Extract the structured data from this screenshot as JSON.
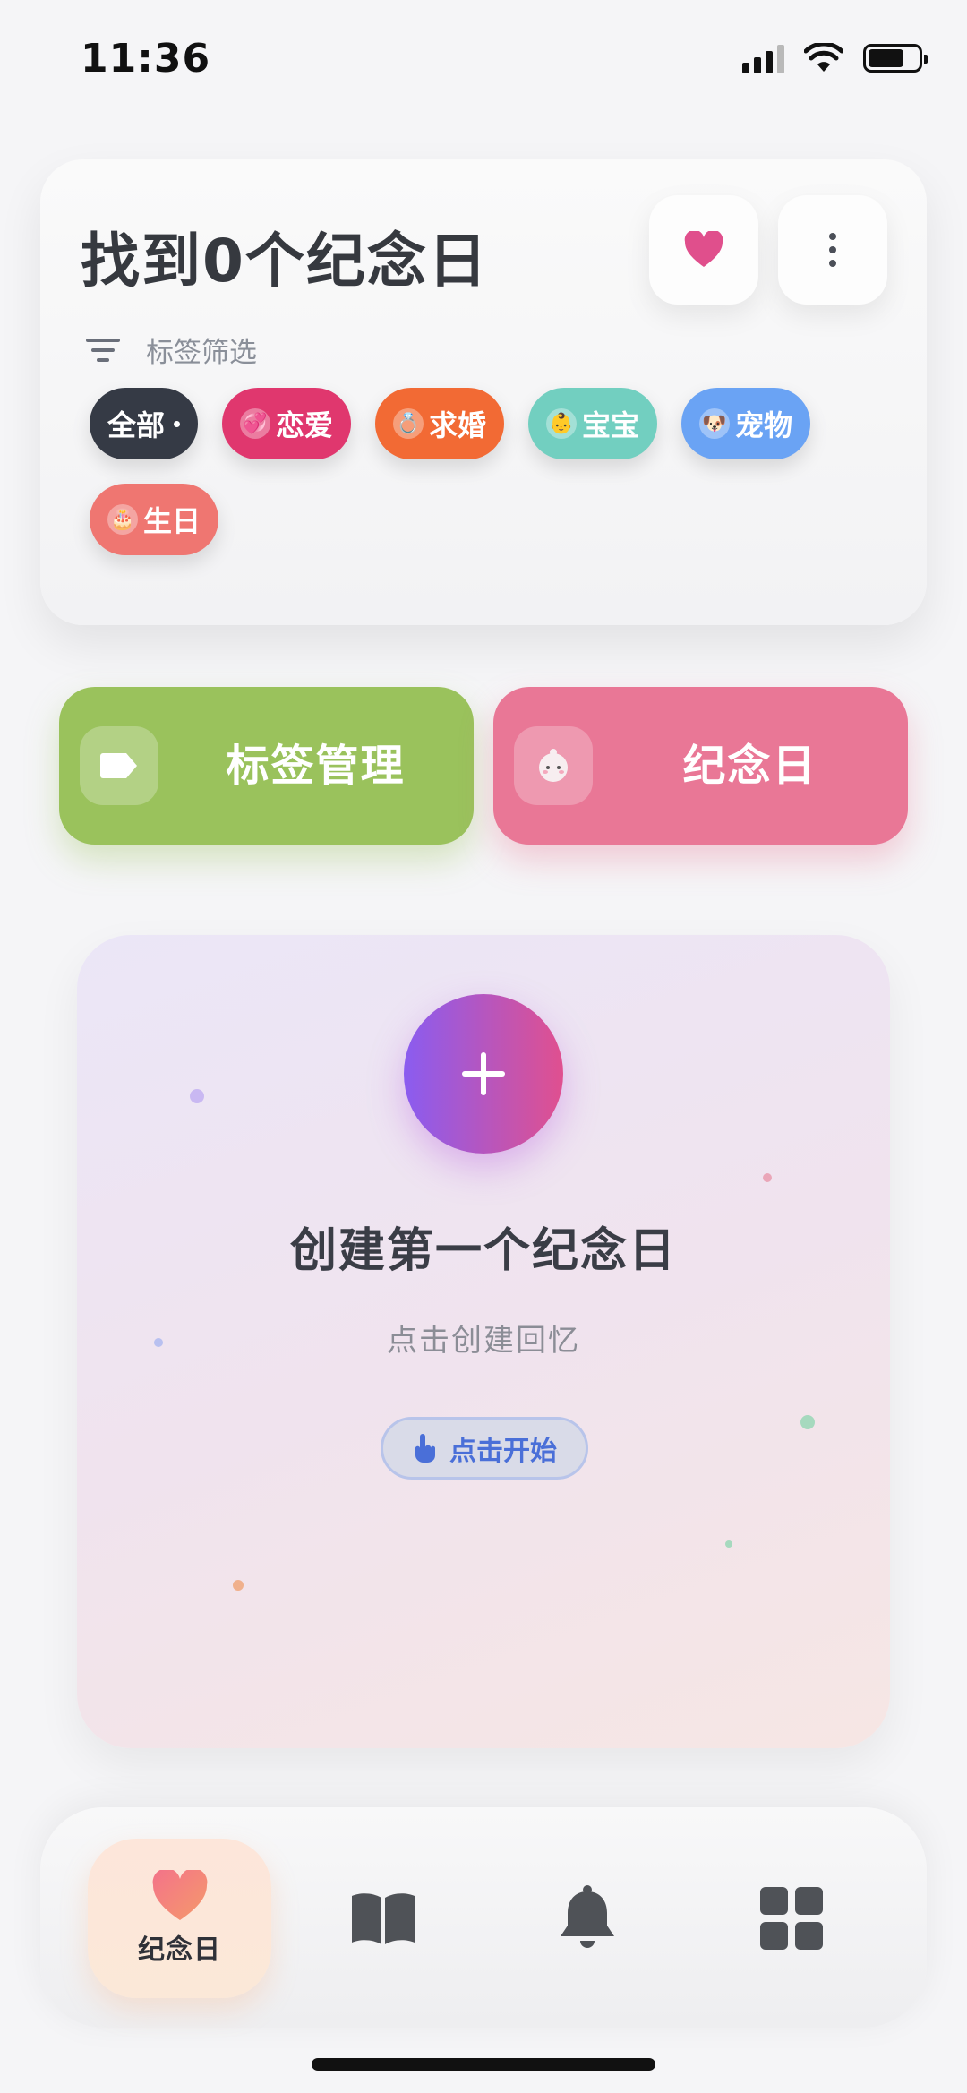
{
  "status_bar": {
    "time": "11:36"
  },
  "header": {
    "title": "找到0个纪念日"
  },
  "filter": {
    "label": "标签筛选"
  },
  "tags": [
    {
      "label": "全部",
      "color": "#353a45",
      "emoji": ""
    },
    {
      "label": "恋爱",
      "color": "#e0376e",
      "emoji": "💞"
    },
    {
      "label": "求婚",
      "color": "#f26a34",
      "emoji": "💍"
    },
    {
      "label": "宝宝",
      "color": "#72cfc0",
      "emoji": "👶"
    },
    {
      "label": "宠物",
      "color": "#6aa3f4",
      "emoji": "🐶"
    },
    {
      "label": "生日",
      "color": "#ef7671",
      "emoji": "🎂"
    }
  ],
  "actions": {
    "tags_label": "标签管理",
    "anniversary_label": "纪念日"
  },
  "empty_state": {
    "title": "创建第一个纪念日",
    "subtitle": "点击创建回忆",
    "cta_label": "点击开始"
  },
  "nav": {
    "home_label": "纪念日"
  },
  "colors": {
    "accent_pink": "#e04f8c",
    "tag_green": "#9ac25c",
    "anniversary_pink": "#e97796",
    "plus_gradient_start": "#8a5cf0",
    "plus_gradient_end": "#e0508f"
  }
}
